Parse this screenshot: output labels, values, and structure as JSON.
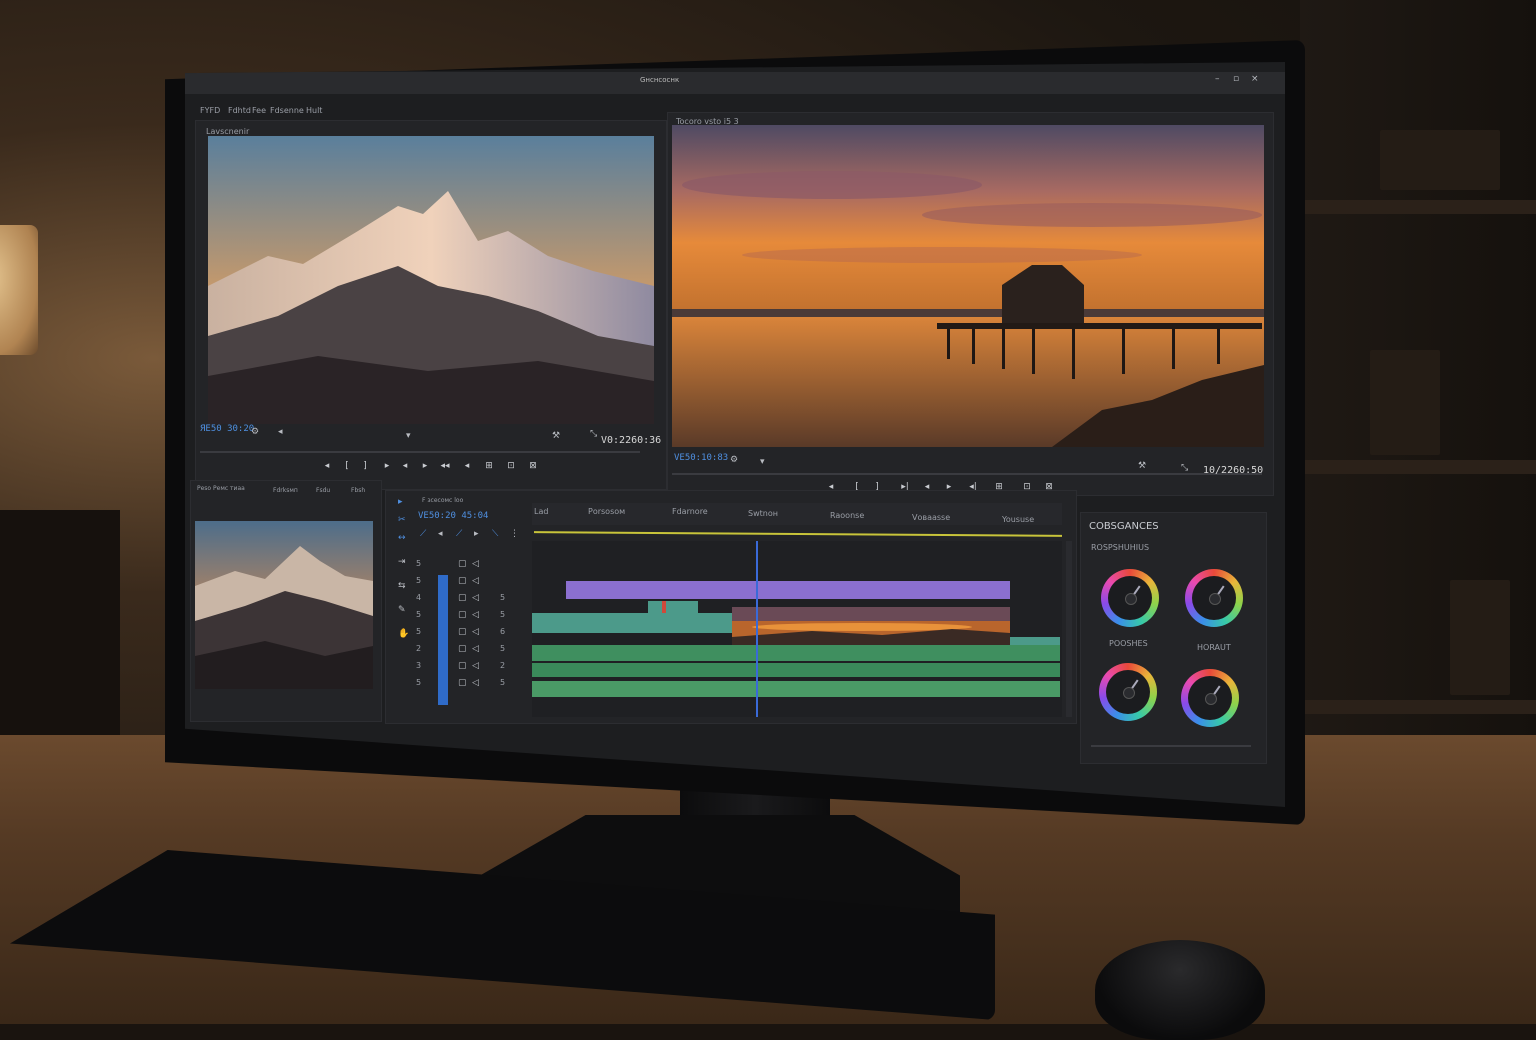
{
  "window": {
    "title": "Gнснсоснк",
    "menu": [
      "FYFD",
      "Fdhtd",
      "Fee",
      "Fdsenne",
      "Hult"
    ]
  },
  "source_monitor": {
    "label": "Lavscnenir",
    "timecode_left": "ЯЕ50 30:20",
    "timecode_right": "V0:2260:36"
  },
  "program_monitor": {
    "label": "Tocoro vsto i5 3",
    "timecode_left": "VЕ50:10:83",
    "timecode_right": "10/2260:50"
  },
  "transport": {
    "source_buttons": [
      "◂",
      "[",
      "]",
      "▸",
      "◂",
      "▸",
      "◂◂",
      "◂",
      "⊞",
      "⊡",
      "⊠"
    ],
    "program_buttons": [
      "◂",
      "[",
      "]",
      "▸|",
      "◂",
      "▸",
      "◂|",
      "⊞",
      "⊡",
      "⊠"
    ]
  },
  "project_panel": {
    "tabs": [
      "Pеsо Ремс тиаа",
      "Fdrksмп",
      "Fsdu",
      "Fbsh"
    ]
  },
  "timeline": {
    "header_label": "F зсеcомс lоо",
    "timecode": "VЕ50:20 45:04",
    "track_numbers": [
      "5",
      "5",
      "4",
      "5",
      "5",
      "2",
      "3",
      "5"
    ],
    "right_numbers": [
      "5",
      "5",
      "6",
      "5",
      "2",
      "5"
    ],
    "ruler_labels": [
      "Lad",
      "Pоrsosoм",
      "Fdarnоre",
      "Swtnон",
      "Raoonse",
      "Vовааsse",
      "Yoususе"
    ]
  },
  "color_panel": {
    "title": "COBSGANCES",
    "subtitle": "ROSPSHUHIUS",
    "wheel_labels": [
      "POOSHES",
      "HORAUT"
    ]
  },
  "colors": {
    "accent_blue": "#3a7bd5",
    "video_clip_purple": "#8b6fd0",
    "audio_clip_green": "#3f8f5f",
    "audio_clip_teal": "#4c9a8a",
    "ruler_line_yellow": "#c8c43a"
  }
}
